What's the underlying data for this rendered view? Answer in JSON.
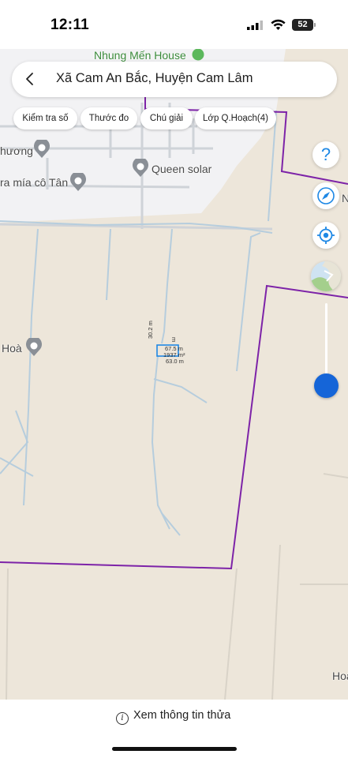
{
  "status_bar": {
    "time": "12:11",
    "battery": "52"
  },
  "search": {
    "title": "Xã Cam An Bắc, Huyện Cam Lâm"
  },
  "toolbar": {
    "chips": [
      "Kiểm tra số",
      "Thước đo",
      "Chú giải",
      "Lớp Q.Hoạch(4)"
    ]
  },
  "map": {
    "labels": {
      "house": "Nhung Mến House",
      "queen_solar": "Queen solar",
      "huong": "hương",
      "ra_mia": "ra mía cô Tân",
      "hoa": "Hoà",
      "hoa_right": "Hoà",
      "n_label": "N"
    },
    "parcel": {
      "side_left": "30.2 m",
      "side_right": "m",
      "length_top": "67.5 m",
      "area": "1937 m²",
      "length_bottom": "63.0 m"
    },
    "colors": {
      "boundary": "#7d23a8",
      "parcel": "#1e88e5",
      "zoom_knob": "#1565d8"
    }
  },
  "right_buttons": [
    "help-icon",
    "compass-icon",
    "locate-icon",
    "layer-icon"
  ],
  "bottom": {
    "info_label": "Xem thông tin thửa"
  }
}
